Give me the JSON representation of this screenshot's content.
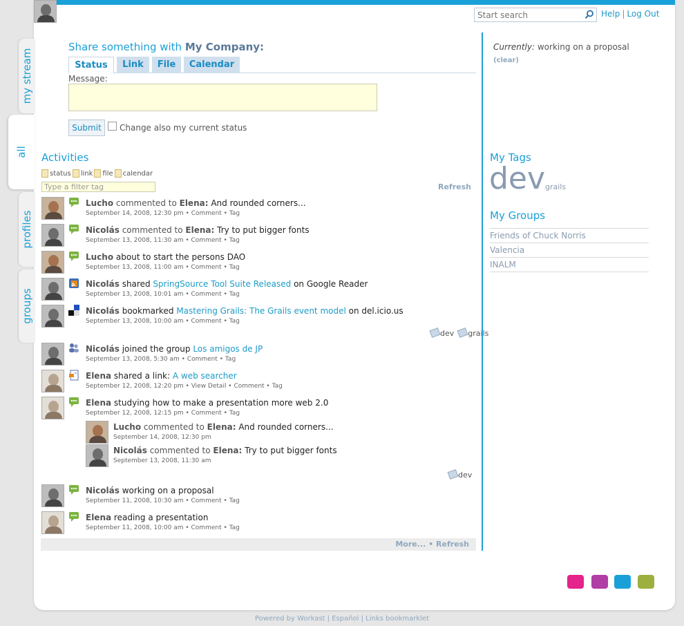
{
  "header": {
    "search_placeholder": "Start search",
    "links": [
      "Help",
      "Log Out"
    ]
  },
  "sidenav": [
    "my stream",
    "all",
    "profiles",
    "groups"
  ],
  "share": {
    "title_prefix": "Share something with",
    "title_target": "My Company:",
    "tabs": [
      "Status",
      "Link",
      "File",
      "Calendar"
    ],
    "message_label": "Message:",
    "submit_label": "Submit",
    "checkbox_label": "Change also my current status"
  },
  "activities": {
    "title": "Activities",
    "filters": [
      "status",
      "link",
      "file",
      "calendar"
    ],
    "filter_placeholder": "Type a filter tag",
    "refresh_label": "Refresh",
    "items": [
      {
        "who": "Lucho",
        "verb": "commented to",
        "target": "Elena:",
        "text": "And rounded corners...",
        "meta": "September 14, 2008, 12:30 pm • Comment • Tag"
      },
      {
        "who": "Nicolás",
        "verb": "commented to",
        "target": "Elena:",
        "text": "Try to put bigger fonts",
        "meta": "September 13, 2008, 11:30 am • Comment • Tag"
      },
      {
        "who": "Lucho",
        "text": "about to start the persons DAO",
        "meta": "September 13, 2008, 11:00 am • Comment • Tag"
      },
      {
        "who": "Nicolás",
        "text": "shared",
        "link": "SpringSource Tool Suite Released",
        "after": "on Google Reader",
        "meta": "September 13, 2008, 10:01 am • Comment • Tag"
      },
      {
        "who": "Nicolás",
        "text": "bookmarked",
        "link": "Mastering Grails: The Grails event model",
        "after": "on del.icio.us",
        "meta": "September 13, 2008, 10:00 am • Comment • Tag",
        "tags": [
          "dev",
          "grails"
        ]
      },
      {
        "who": "Nicolás",
        "text": "joined the group",
        "link": "Los amigos de JP",
        "meta": "September 13, 2008, 5:30 am • Comment • Tag"
      },
      {
        "who": "Elena",
        "text": "shared a link:",
        "link": "A web searcher",
        "meta": "September 12, 2008, 12:20 pm • View Detail • Comment • Tag"
      },
      {
        "who": "Elena",
        "text": "studying how to make a presentation more web 2.0",
        "meta": "September 12, 2008, 12:15 pm • Comment • Tag",
        "tags": [
          "dev"
        ],
        "replies": [
          {
            "who": "Lucho",
            "verb": "commented to",
            "target": "Elena:",
            "text": "And rounded corners...",
            "meta": "September 14, 2008, 12:30 pm"
          },
          {
            "who": "Nicolás",
            "verb": "commented to",
            "target": "Elena:",
            "text": "Try to put bigger fonts",
            "meta": "September 13, 2008, 11:30 am"
          }
        ]
      },
      {
        "who": "Nicolás",
        "text": "working on a proposal",
        "meta": "September 11, 2008, 10:30 am • Comment • Tag"
      },
      {
        "who": "Elena",
        "text": "reading a presentation",
        "meta": "September 11, 2008, 10:00 am • Comment • Tag"
      }
    ],
    "more_label": "More...",
    "bullet": "•",
    "refresh_bottom_label": "Refresh"
  },
  "status": {
    "currently_label": "Currently:",
    "currently_value": "working on a proposal",
    "clear_label": "(clear)"
  },
  "tags": {
    "title": "My Tags",
    "items": [
      "dev",
      "grails"
    ]
  },
  "groups": {
    "title": "My Groups",
    "items": [
      "Friends of Chuck Norris",
      "Valencia",
      "INALM"
    ]
  },
  "themes": {
    "colors": [
      "#e4238b",
      "#b13ea5",
      "#1aa0d8",
      "#9daf3f"
    ]
  },
  "footer": {
    "text": "Powered by Workast | Español | Links bookmarklet"
  }
}
